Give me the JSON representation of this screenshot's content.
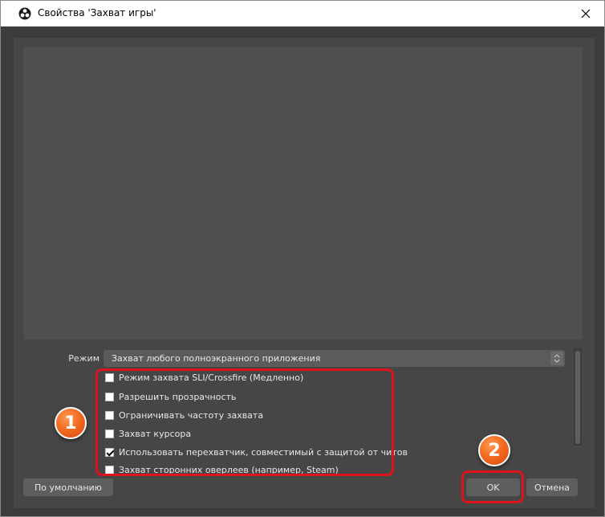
{
  "window": {
    "title": "Свойства 'Захват игры'",
    "app_icon": "obs-icon",
    "close_icon": "close-icon"
  },
  "mode": {
    "label": "Режим",
    "selected": "Захват любого полноэкранного приложения"
  },
  "options": [
    {
      "label": "Режим захвата SLI/Crossfire (Медленно)",
      "checked": false
    },
    {
      "label": "Разрешить прозрачность",
      "checked": false
    },
    {
      "label": "Ограничивать частоту захвата",
      "checked": false
    },
    {
      "label": "Захват курсора",
      "checked": false
    },
    {
      "label": "Использовать перехватчик, совместимый с защитой от читов",
      "checked": true
    },
    {
      "label": "Захват сторонних оверлеев (например, Steam)",
      "checked": false
    }
  ],
  "buttons": {
    "defaults": "По умолчанию",
    "ok": "OK",
    "cancel": "Отмена"
  },
  "annotations": {
    "badge1": "1",
    "badge2": "2",
    "highlight_color": "#e0121e",
    "badge_color": "#f26b21"
  }
}
